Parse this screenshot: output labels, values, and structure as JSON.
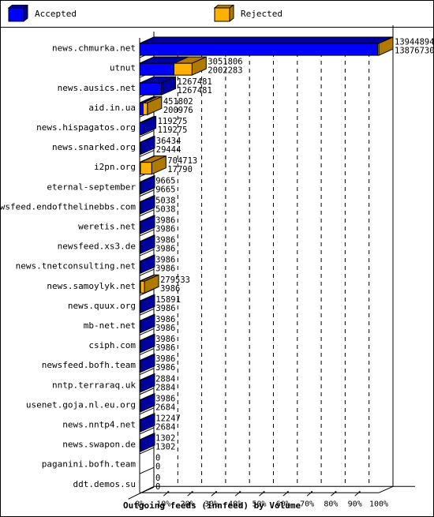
{
  "chart_data": {
    "type": "bar",
    "orientation": "horizontal",
    "style": "3d",
    "title": "Outgoing feeds (innfeed) by Volume",
    "xlabel": "",
    "ylabel": "",
    "xlim_percent": [
      0,
      100
    ],
    "x_ticks": [
      "0%",
      "10%",
      "20%",
      "30%",
      "40%",
      "50%",
      "60%",
      "70%",
      "80%",
      "90%",
      "100%"
    ],
    "grid": "vertical dashed",
    "legend_position": "top",
    "series": [
      {
        "name": "Accepted",
        "color": "#0000ff",
        "side_color": "#00009e"
      },
      {
        "name": "Rejected",
        "color": "#ffb000",
        "side_color": "#b07a00"
      }
    ],
    "categories": [
      "news.chmurka.net",
      "utnut",
      "news.ausics.net",
      "aid.in.ua",
      "news.hispagatos.org",
      "news.snarked.org",
      "i2pn.org",
      "eternal-september",
      "newsfeed.endofthelinebbs.com",
      "weretis.net",
      "newsfeed.xs3.de",
      "news.tnetconsulting.net",
      "news.samoylyk.net",
      "news.quux.org",
      "mb-net.net",
      "csiph.com",
      "newsfeed.bofh.team",
      "nntp.terraraq.uk",
      "usenet.goja.nl.eu.org",
      "news.nntp4.net",
      "news.swapon.de",
      "paganini.bofh.team",
      "ddt.demos.su"
    ],
    "values_top": [
      13944894,
      3051806,
      1267481,
      451802,
      119275,
      36434,
      704713,
      9665,
      5038,
      3986,
      3986,
      3986,
      279533,
      15891,
      3986,
      3986,
      3986,
      2884,
      3986,
      12247,
      1302,
      0,
      0
    ],
    "values_bottom": [
      13876730,
      2002283,
      1267481,
      200976,
      119275,
      29444,
      17790,
      9665,
      5038,
      3986,
      3986,
      3986,
      3986,
      3986,
      3986,
      3986,
      3986,
      2884,
      2684,
      2684,
      1302,
      0,
      0
    ],
    "value_labels_top": [
      "13944894",
      "3051806",
      "1267481",
      "451802",
      "119275",
      "36434",
      "704713",
      "9665",
      "5038",
      "3986",
      "3986",
      "3986",
      "279533",
      "15891",
      "3986",
      "3986",
      "3986",
      "2884",
      "3986",
      "12247",
      "1302",
      "0",
      "0"
    ],
    "value_labels_bottom": [
      "13876730",
      "2002283",
      "1267481",
      "200976",
      "119275",
      "29444",
      "17790",
      "9665",
      "5038",
      "3986",
      "3986",
      "3986",
      "3986",
      "3986",
      "3986",
      "3986",
      "3986",
      "2884",
      "2684",
      "2684",
      "1302",
      "0",
      "0"
    ],
    "max_value": 13944894
  },
  "legend": {
    "accepted_label": "Accepted",
    "rejected_label": "Rejected"
  }
}
